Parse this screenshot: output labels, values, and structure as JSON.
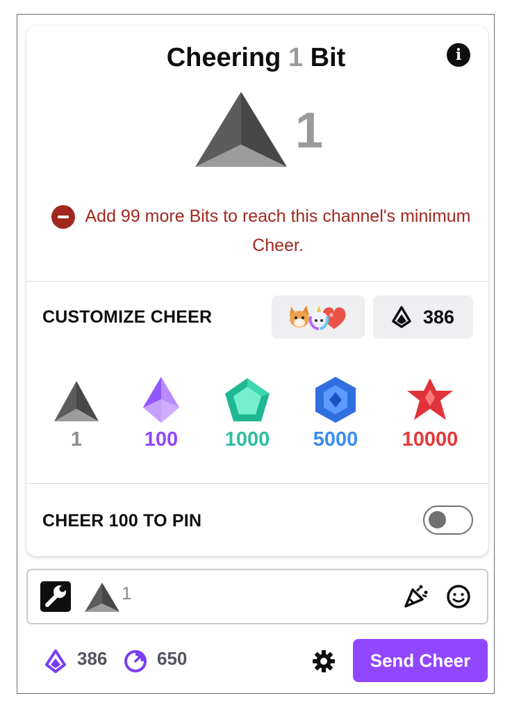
{
  "header": {
    "title_prefix": "Cheering",
    "title_count": "1",
    "title_suffix": "Bit",
    "big_count": "1"
  },
  "warning": {
    "text": "Add 99 more Bits to reach this channel's minimum Cheer."
  },
  "customize": {
    "label": "CUSTOMIZE CHEER",
    "balance": "386"
  },
  "tiers": [
    {
      "label": "1",
      "color": "#8b8b8b"
    },
    {
      "label": "100",
      "color": "#9147ff"
    },
    {
      "label": "1000",
      "color": "#2bbfa0"
    },
    {
      "label": "5000",
      "color": "#3a8ef0"
    },
    {
      "label": "10000",
      "color": "#e03a3a"
    }
  ],
  "pin": {
    "label": "CHEER 100 TO PIN",
    "enabled": false
  },
  "input": {
    "cheer_count": "1"
  },
  "footer": {
    "bits_balance": "386",
    "points_balance": "650",
    "send_label": "Send Cheer"
  },
  "colors": {
    "accent": "#9147ff",
    "warning": "#a0281f"
  }
}
